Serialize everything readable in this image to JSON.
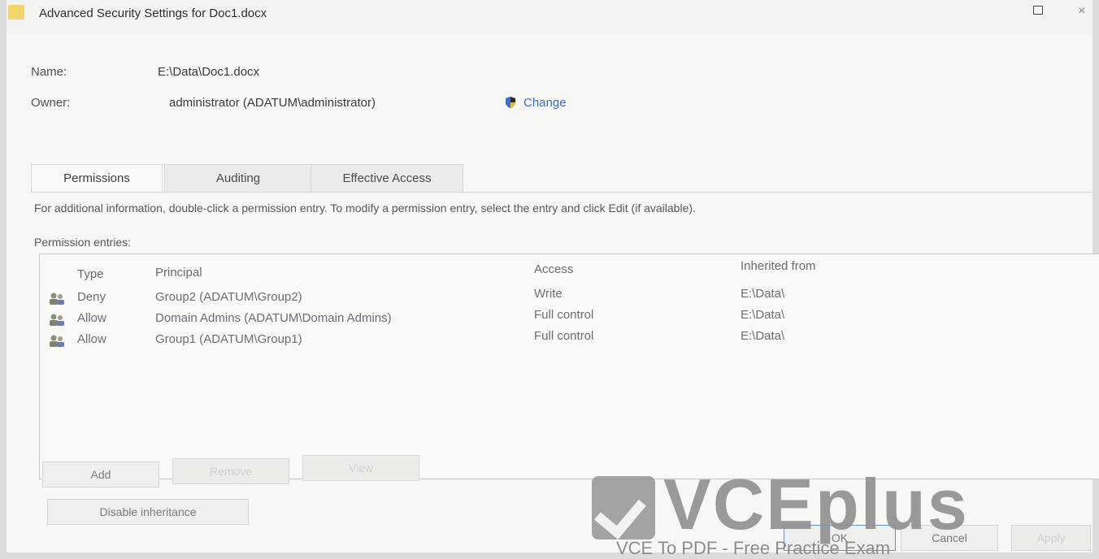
{
  "window": {
    "title": "Advanced Security Settings for Doc1.docx",
    "close_glyph": "×"
  },
  "properties": {
    "name_label": "Name:",
    "name_value": "E:\\Data\\Doc1.docx",
    "owner_label": "Owner:",
    "owner_value": "administrator (ADATUM\\administrator)",
    "change_label": "Change",
    "change_icon": "shield-icon"
  },
  "tabs": [
    {
      "label": "Permissions",
      "active": true
    },
    {
      "label": "Auditing",
      "active": false
    },
    {
      "label": "Effective Access",
      "active": false
    }
  ],
  "info_text": "For additional information, double-click a permission entry. To modify a permission entry, select the entry and click Edit (if available).",
  "entries_label": "Permission entries:",
  "table": {
    "columns": [
      "Type",
      "Principal",
      "Access",
      "Inherited from"
    ],
    "rows": [
      {
        "icon": "group-icon",
        "type": "Deny",
        "principal": "Group2 (ADATUM\\Group2)",
        "access": "Write",
        "inherited_from": "E:\\Data\\"
      },
      {
        "icon": "group-icon",
        "type": "Allow",
        "principal": "Domain Admins (ADATUM\\Domain Admins)",
        "access": "Full control",
        "inherited_from": "E:\\Data\\"
      },
      {
        "icon": "group-icon",
        "type": "Allow",
        "principal": "Group1 (ADATUM\\Group1)",
        "access": "Full control",
        "inherited_from": "E:\\Data\\"
      }
    ]
  },
  "buttons": {
    "add": "Add",
    "remove": "Remove",
    "view": "View",
    "disable_inheritance": "Disable inheritance",
    "ok": "OK",
    "cancel": "Cancel",
    "apply": "Apply"
  },
  "watermark": {
    "brand": "VCEplus",
    "tagline": "VCE To PDF - Free Practice Exam"
  }
}
